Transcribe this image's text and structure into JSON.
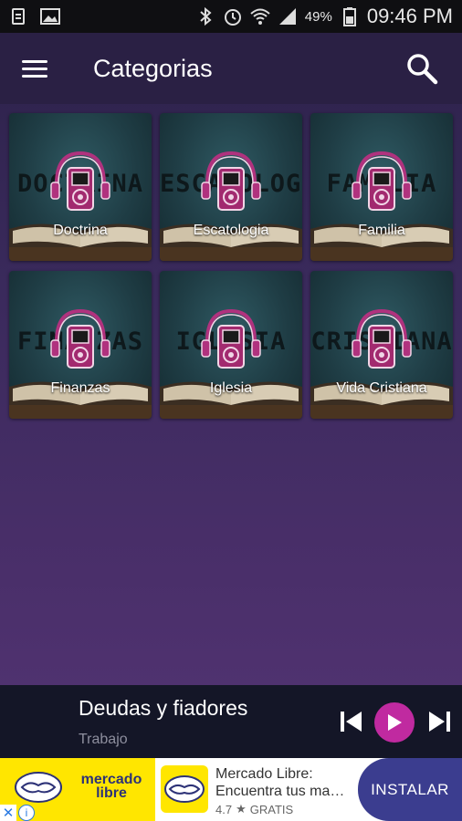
{
  "status_bar": {
    "battery_text": "49%",
    "time": "09:46 PM",
    "icons": [
      "sim-card-icon",
      "image-icon",
      "bluetooth-icon",
      "alarm-icon",
      "wifi-icon",
      "signal-icon",
      "battery-icon"
    ]
  },
  "app_bar": {
    "title": "Categorias"
  },
  "categories": [
    {
      "label": "Doctrina",
      "bg_word": "DOCTRINA"
    },
    {
      "label": "Escatologia",
      "bg_word": "ESCATOLOGIA"
    },
    {
      "label": "Familia",
      "bg_word": "FAMILIA"
    },
    {
      "label": "Finanzas",
      "bg_word": "FINANZAS"
    },
    {
      "label": "Iglesia",
      "bg_word": "IGLESIA"
    },
    {
      "label": "Vida Cristiana",
      "bg_word": "CRISTIANA"
    }
  ],
  "player": {
    "title": "Deudas y fiadores",
    "subtitle": "Trabajo"
  },
  "ad": {
    "logo_text": "mercado libre",
    "title": "Mercado Libre: Encuentra tus ma…",
    "rating": "4.7",
    "price": "GRATIS",
    "install_label": "INSTALAR"
  },
  "colors": {
    "accent": "#c02aa0",
    "app_bar": "#2a2044",
    "player_bg": "#141627",
    "ad_yellow": "#ffe600",
    "ad_button": "#3b3d8f"
  }
}
